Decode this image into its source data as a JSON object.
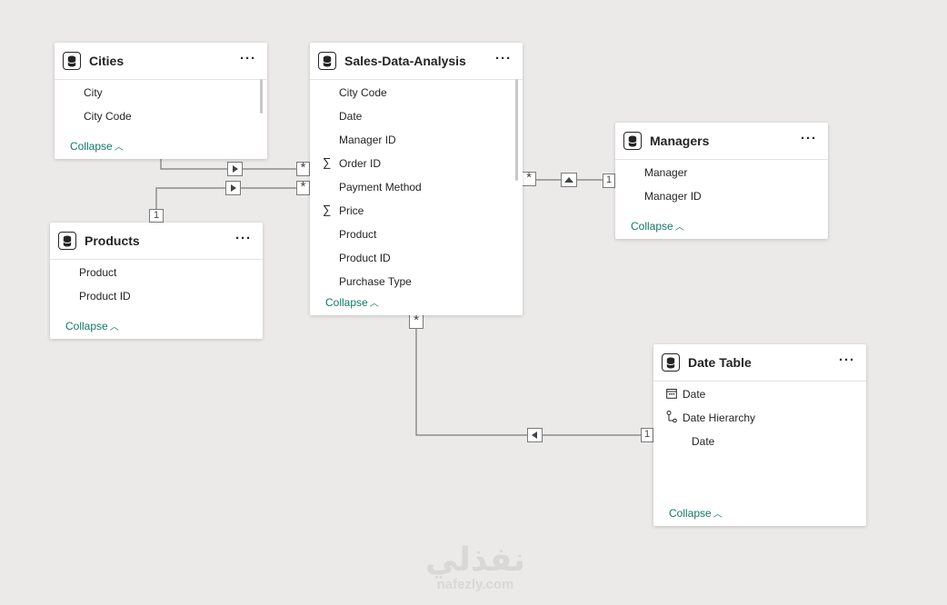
{
  "tables": {
    "cities": {
      "title": "Cities",
      "fields": [
        "City",
        "City Code"
      ],
      "collapse_label": "Collapse"
    },
    "sales": {
      "title": "Sales-Data-Analysis",
      "fields": [
        "City Code",
        "Date",
        "Manager ID",
        "Order ID",
        "Payment Method",
        "Price",
        "Product",
        "Product ID",
        "Purchase Type"
      ],
      "collapse_label": "Collapse"
    },
    "managers": {
      "title": "Managers",
      "fields": [
        "Manager",
        "Manager ID"
      ],
      "collapse_label": "Collapse"
    },
    "products": {
      "title": "Products",
      "fields": [
        "Product",
        "Product ID"
      ],
      "collapse_label": "Collapse"
    },
    "date_table": {
      "title": "Date Table",
      "fields": [
        "Date",
        "Date Hierarchy",
        "Date"
      ],
      "collapse_label": "Collapse"
    }
  },
  "more_label": "···",
  "cardinality": {
    "one": "1",
    "many": "*"
  },
  "icons": {
    "table": "database-icon",
    "sum": "∑",
    "calendar": "calendar-icon",
    "hierarchy": "hierarchy-icon"
  },
  "watermark": {
    "arabic": "نفذلي",
    "latin": "nafezly.com"
  },
  "colors": {
    "background": "#ebeae9",
    "collapse_link": "#117865",
    "line": "#7a7a7a"
  }
}
